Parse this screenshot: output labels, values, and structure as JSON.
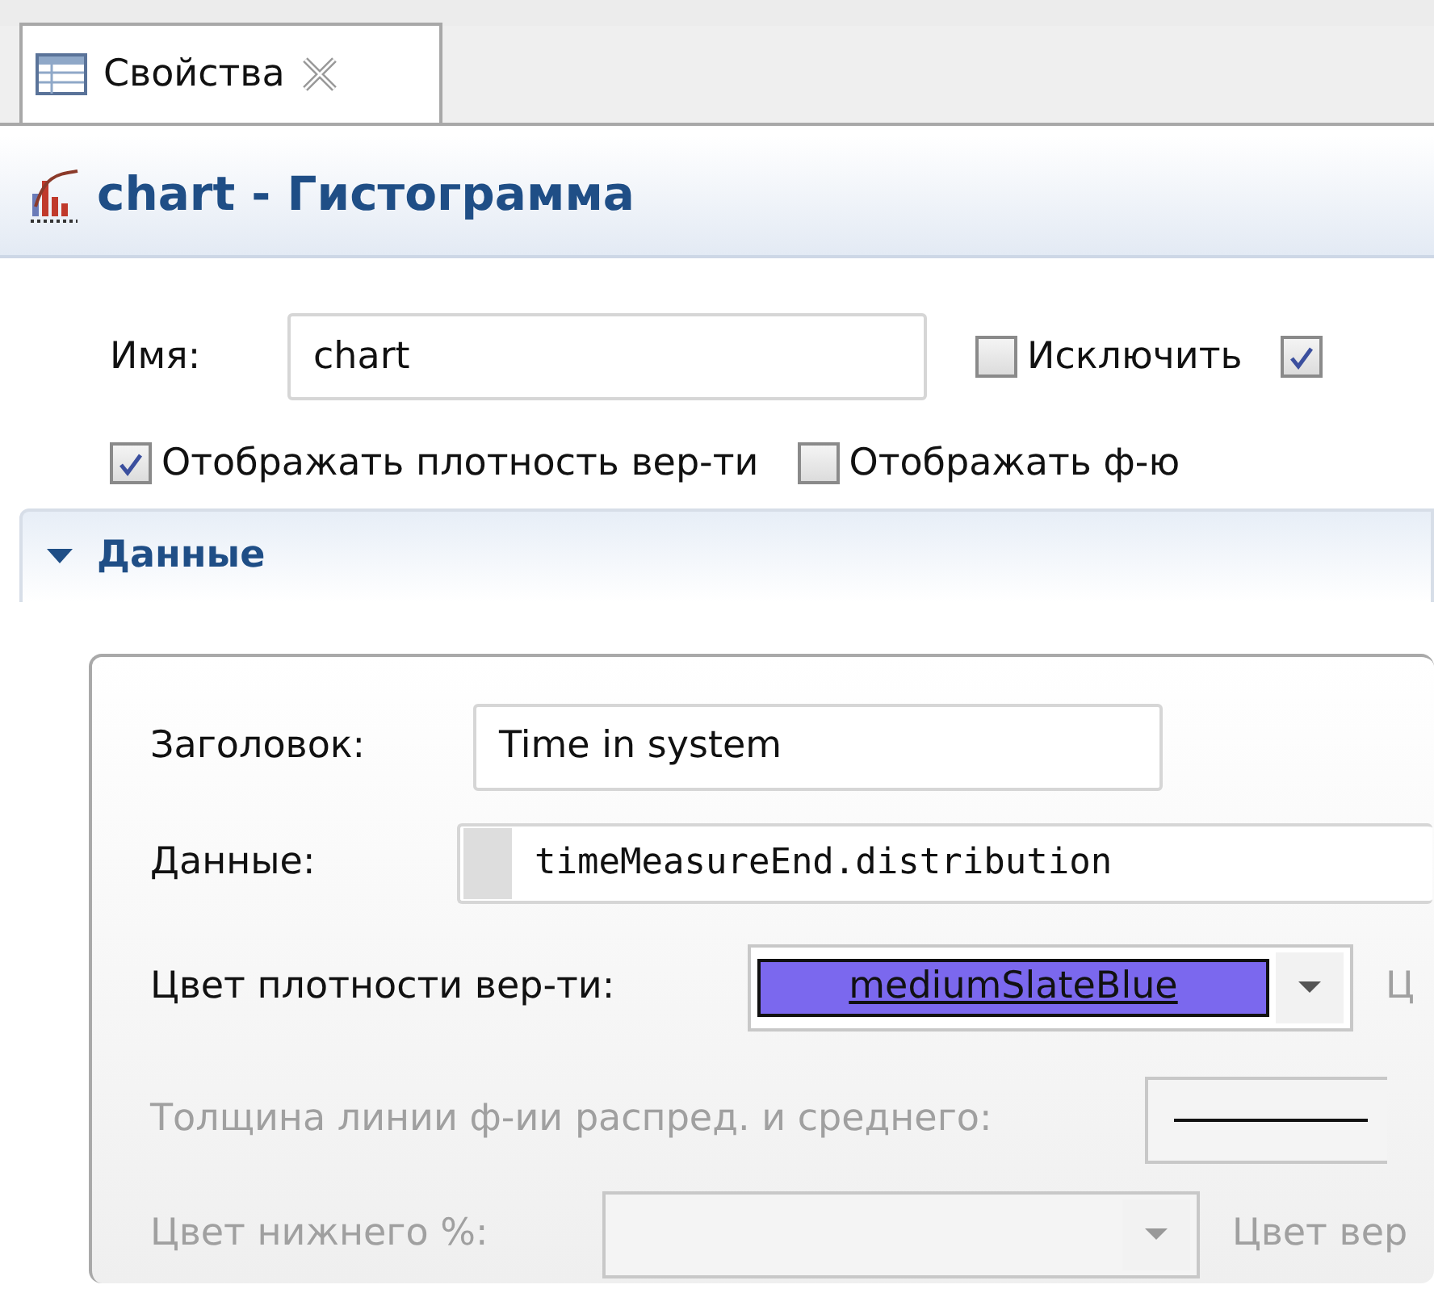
{
  "tabs": [
    {
      "label": "Свойства",
      "selected": true
    }
  ],
  "title": "chart - Гистограмма",
  "name_field": {
    "label": "Имя:",
    "value": "chart"
  },
  "options": [
    {
      "label": "Исключить",
      "checked": false
    },
    {
      "checked": true
    }
  ],
  "display_options": [
    {
      "label": "Отображать плотность вер-ти",
      "checked": true
    },
    {
      "label": "Отображать ф-ю",
      "checked": false
    }
  ],
  "section": {
    "title": "Данные",
    "expanded": true,
    "fields": [
      {
        "kind": "text",
        "label": "Заголовок:",
        "value": "Time in system",
        "disabled": false
      },
      {
        "kind": "code",
        "label": "Данные:",
        "value": "timeMeasureEnd.distribution",
        "disabled": false
      },
      {
        "kind": "color",
        "label": "Цвет плотности вер-ти:",
        "value": "mediumSlateBlue",
        "color": "#7b68ee",
        "disabled": false,
        "next_label": "Ц"
      },
      {
        "kind": "line",
        "label": "Толщина линии ф-ии распред. и среднего:",
        "disabled": true
      },
      {
        "kind": "color",
        "label": "Цвет нижнего %:",
        "disabled": true,
        "next_label": "Цвет вер"
      }
    ]
  }
}
